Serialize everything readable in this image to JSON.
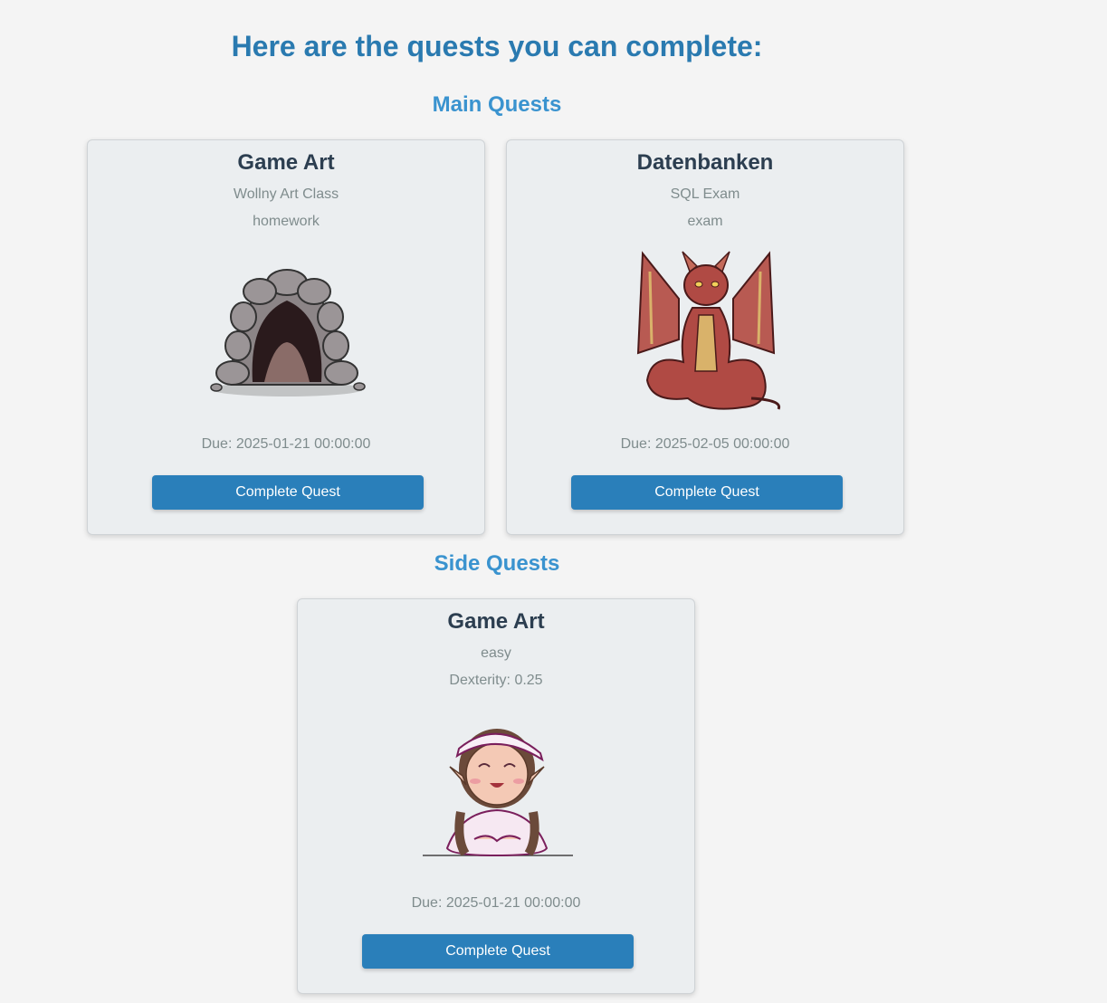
{
  "page_title": "Here are the quests you can complete:",
  "main_quests": {
    "heading": "Main Quests",
    "cards": [
      {
        "title": "Game Art",
        "line1": "Wollny Art Class",
        "line2": "homework",
        "image": "cave-image",
        "due": "Due: 2025-01-21 00:00:00",
        "button": "Complete Quest"
      },
      {
        "title": "Datenbanken",
        "line1": "SQL Exam",
        "line2": "exam",
        "image": "dragon-image",
        "due": "Due: 2025-02-05 00:00:00",
        "button": "Complete Quest"
      }
    ]
  },
  "side_quests": {
    "heading": "Side Quests",
    "cards": [
      {
        "title": "Game Art",
        "line1": "easy",
        "line2": "Dexterity: 0.25",
        "image": "elf-girl-image",
        "due": "Due: 2025-01-21 00:00:00",
        "button": "Complete Quest"
      }
    ]
  },
  "colors": {
    "title": "#2a7ab0",
    "section": "#3a93cf",
    "button": "#2a7fba",
    "card_bg": "#ebeef0"
  }
}
